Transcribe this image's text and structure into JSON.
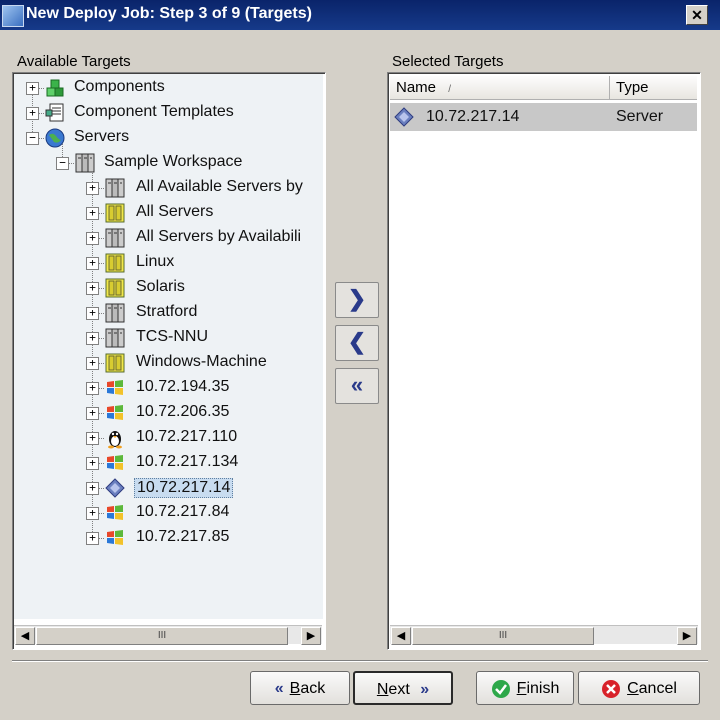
{
  "window": {
    "title": "New Deploy Job: Step 3 of 9 (Targets)",
    "close_label": "✕"
  },
  "available": {
    "title": "Available Targets",
    "tree": [
      {
        "label": "Components",
        "icon": "component-icon",
        "expander": "+"
      },
      {
        "label": "Component Templates",
        "icon": "template-icon",
        "expander": "+"
      },
      {
        "label": "Servers",
        "icon": "globe-icon",
        "expander": "−"
      },
      {
        "label": "Sample Workspace",
        "icon": "server-group-icon",
        "expander": "−"
      },
      {
        "label": "All Available Servers by",
        "icon": "server-group-icon",
        "expander": "+"
      },
      {
        "label": "All Servers",
        "icon": "smart-group-icon",
        "expander": "+"
      },
      {
        "label": "All Servers by Availabili",
        "icon": "server-group-icon",
        "expander": "+"
      },
      {
        "label": "Linux",
        "icon": "smart-group-icon",
        "expander": "+"
      },
      {
        "label": "Solaris",
        "icon": "smart-group-icon",
        "expander": "+"
      },
      {
        "label": "Stratford",
        "icon": "server-group-icon",
        "expander": "+"
      },
      {
        "label": "TCS-NNU",
        "icon": "server-group-icon",
        "expander": "+"
      },
      {
        "label": "Windows-Machine",
        "icon": "smart-group-icon",
        "expander": "+"
      },
      {
        "label": "10.72.194.35",
        "icon": "windows-icon",
        "expander": "+"
      },
      {
        "label": "10.72.206.35",
        "icon": "windows-icon",
        "expander": "+"
      },
      {
        "label": "10.72.217.110",
        "icon": "linux-icon",
        "expander": "+"
      },
      {
        "label": "10.72.217.134",
        "icon": "windows-icon",
        "expander": "+"
      },
      {
        "label": "10.72.217.14",
        "icon": "diamond-server-icon",
        "expander": "+",
        "selected": true
      },
      {
        "label": "10.72.217.84",
        "icon": "windows-icon",
        "expander": "+"
      },
      {
        "label": "10.72.217.85",
        "icon": "windows-icon",
        "expander": "+"
      }
    ],
    "scroll_thumb": "III"
  },
  "transfer": {
    "add": "❯",
    "remove": "❮",
    "remove_all": "«"
  },
  "selected": {
    "title": "Selected Targets",
    "columns": {
      "name": "Name",
      "sort_glyph": "/",
      "type": "Type"
    },
    "rows": [
      {
        "name": "10.72.217.14",
        "type": "Server",
        "icon": "diamond-server-icon"
      }
    ],
    "scroll_thumb": "III"
  },
  "footer": {
    "back": {
      "icon": "«",
      "mnemonic": "B",
      "rest": "ack"
    },
    "next": {
      "mnemonic": "N",
      "rest": "ext",
      "icon": "»"
    },
    "finish": {
      "mnemonic": "F",
      "rest": "inish"
    },
    "cancel": {
      "mnemonic": "C",
      "rest": "ancel"
    }
  },
  "colors": {
    "title_bar": "#0a246a",
    "selection": "#c8dcf0",
    "window_bg": "#d4d0c8",
    "finish_icon": "#2ea84a",
    "cancel_icon": "#d8222a"
  }
}
